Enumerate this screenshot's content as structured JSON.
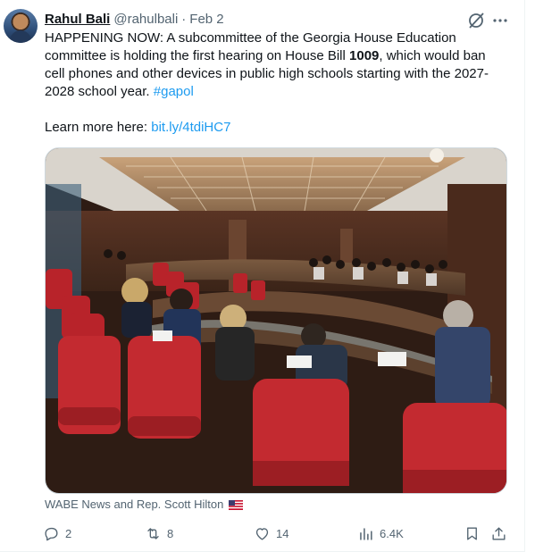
{
  "tweet": {
    "author_name": "Rahul Bali",
    "handle": "@rahulbali",
    "separator": "·",
    "date": "Feb 2",
    "body_line1": "HAPPENING NOW: A subcommittee of the Georgia House Education",
    "body_line2": "committee is holding the first hearing on House Bill ",
    "body_bill": "1009",
    "body_line2_end": ", which would ban",
    "body_line3": "cell phones and other devices in public high schools starting with the 2027-",
    "body_line4": "2028 school year. ",
    "hashtag": "#gapol",
    "learn_more": "Learn more here: ",
    "link": "bit.ly/4tdiHC7",
    "media_caption": "WABE News and Rep. Scott Hilton",
    "caption_flag": "us-flag-emoji"
  },
  "actions": {
    "replies": "2",
    "reposts": "8",
    "likes": "14",
    "views": "6.4K"
  },
  "icons": {
    "reply": "reply-icon",
    "repost": "repost-icon",
    "like": "heart-icon",
    "views": "views-chart-icon",
    "bookmark": "bookmark-icon",
    "share": "share-icon",
    "grok": "grok-icon",
    "more": "more-icon"
  },
  "colors": {
    "link": "#1d9bf0",
    "muted": "#536471",
    "text": "#0f1419"
  }
}
